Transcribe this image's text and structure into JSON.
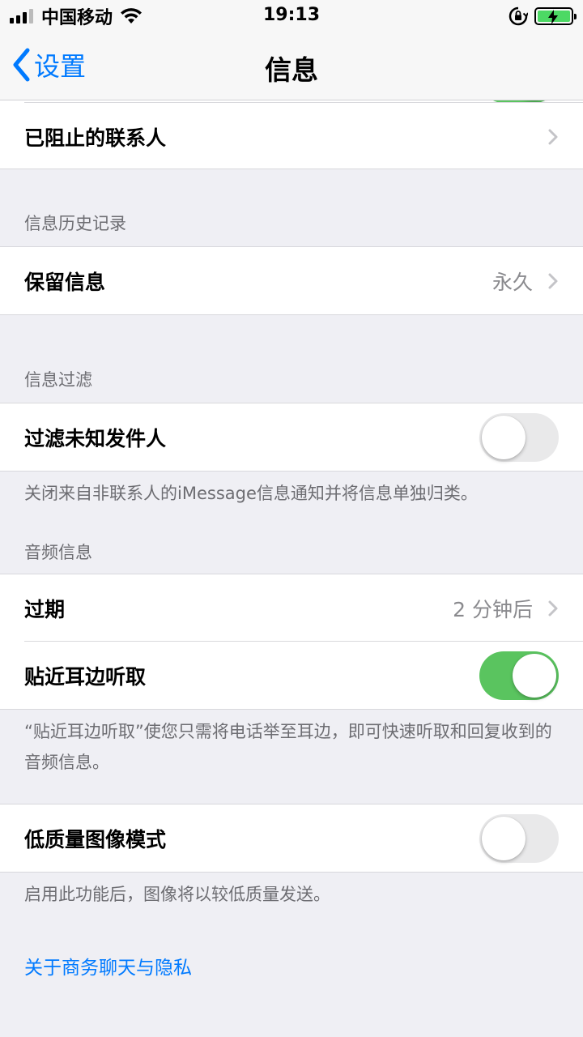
{
  "status_bar": {
    "carrier": "中国移动",
    "time": "19:13"
  },
  "nav": {
    "back_label": "设置",
    "title": "信息"
  },
  "blocked": {
    "label": "已阻止的联系人"
  },
  "history": {
    "header": "信息历史记录",
    "keep_label": "保留信息",
    "keep_value": "永久"
  },
  "filter": {
    "header": "信息过滤",
    "unknown_label": "过滤未知发件人",
    "unknown_on": false,
    "note": "关闭来自非联系人的iMessage信息通知并将信息单独归类。"
  },
  "audio": {
    "header": "音频信息",
    "expire_label": "过期",
    "expire_value": "2 分钟后",
    "raise_label": "贴近耳边听取",
    "raise_on": true,
    "note": "“贴近耳边听取”使您只需将电话举至耳边，即可快速听取和回复收到的音频信息。"
  },
  "low_quality": {
    "label": "低质量图像模式",
    "on": false,
    "note": "启用此功能后，图像将以较低质量发送。"
  },
  "business_link": "关于商务聊天与隐私",
  "colors": {
    "accent": "#007aff",
    "toggle_on": "#5ac45f",
    "background": "#efeff4"
  }
}
